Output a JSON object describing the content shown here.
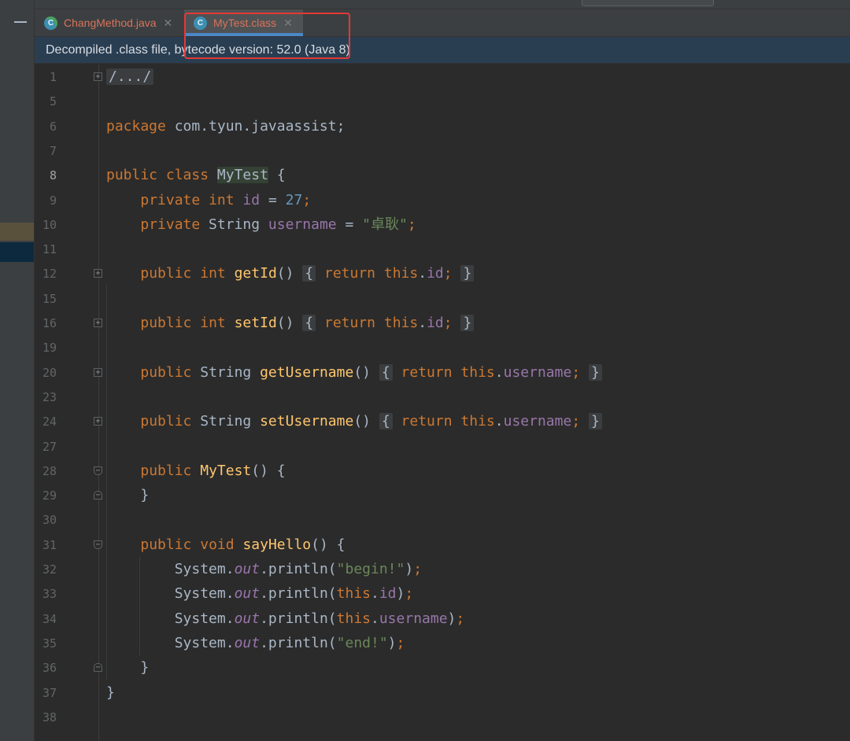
{
  "tabs": [
    {
      "label": "ChangMethod.java",
      "icon": "C",
      "active": false
    },
    {
      "label": "MyTest.class",
      "icon": "C",
      "active": true
    }
  ],
  "banner": "Decompiled .class file, bytecode version: 52.0 (Java 8)",
  "colors": {
    "keyword": "#cc7832",
    "field": "#9876aa",
    "number": "#6897bb",
    "string": "#6a8759",
    "method": "#ffc66d",
    "highlight": "#e53935"
  },
  "code_lines": [
    {
      "n": "1",
      "fold": "plus"
    },
    {
      "n": "5"
    },
    {
      "n": "6"
    },
    {
      "n": "7"
    },
    {
      "n": "8",
      "current": true
    },
    {
      "n": "9"
    },
    {
      "n": "10"
    },
    {
      "n": "11"
    },
    {
      "n": "12",
      "fold": "plus"
    },
    {
      "n": "15"
    },
    {
      "n": "16",
      "fold": "plus"
    },
    {
      "n": "19"
    },
    {
      "n": "20",
      "fold": "plus"
    },
    {
      "n": "23"
    },
    {
      "n": "24",
      "fold": "plus"
    },
    {
      "n": "27"
    },
    {
      "n": "28",
      "fold": "down"
    },
    {
      "n": "29",
      "fold": "up"
    },
    {
      "n": "30"
    },
    {
      "n": "31",
      "fold": "down"
    },
    {
      "n": "32"
    },
    {
      "n": "33"
    },
    {
      "n": "34"
    },
    {
      "n": "35"
    },
    {
      "n": "36",
      "fold": "up"
    },
    {
      "n": "37"
    },
    {
      "n": "38"
    }
  ],
  "code": {
    "l1_fold": "/.../",
    "package_kw": "package",
    "package_name": " com.tyun.javaassist;",
    "public": "public",
    "class": "class",
    "class_name": "MyTest",
    "open_brace": " {",
    "private": "private",
    "int": "int",
    "id": "id",
    "eq": " = ",
    "id_value": "27",
    "semi": ";",
    "string_type": " String ",
    "username": "username",
    "username_value": "\"卓耿\"",
    "get_id": "getId",
    "set_id": "setId",
    "get_username": "getUsername",
    "set_username": "setUsername",
    "parens": "()",
    "fold_open": "{",
    "return": "return",
    "this": "this",
    "dot": ".",
    "fold_close": "}",
    "constructor_name": "MyTest",
    "close_brace": "}",
    "void": "void",
    "say_hello": "sayHello",
    "system": "System",
    "out": "out",
    "println_open": ".println(",
    "begin_str": "\"begin!\"",
    "end_str": "\"end!\"",
    "close_paren": ")"
  }
}
